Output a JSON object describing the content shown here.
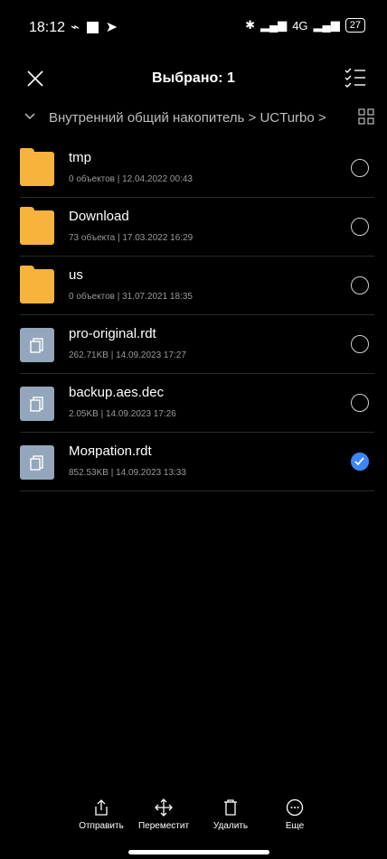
{
  "status_bar": {
    "time": "18:12",
    "network_label": "4G",
    "battery_level": "27"
  },
  "header": {
    "title": "Выбрано: 1"
  },
  "breadcrumb": {
    "path": "Внутренний общий накопитель > UCTurbo >"
  },
  "items": [
    {
      "name": "tmp",
      "meta": "0 объектов  |  12.04.2022 00:43",
      "type": "folder",
      "selected": false
    },
    {
      "name": "Download",
      "meta": "73 объекта  |  17.03.2022 16:29",
      "type": "folder",
      "selected": false
    },
    {
      "name": "us",
      "meta": "0 объектов  |  31.07.2021 18:35",
      "type": "folder",
      "selected": false
    },
    {
      "name": "pro-original.rdt",
      "meta": "262.71KB  |  14.09.2023 17:27",
      "type": "file",
      "selected": false
    },
    {
      "name": "backup.aes.dec",
      "meta": "2.05KB  |  14.09.2023 17:26",
      "type": "file",
      "selected": false
    },
    {
      "name": "Мояраtion.rdt",
      "meta": "852.53KB  |  14.09.2023 13:33",
      "type": "file",
      "selected": true
    }
  ],
  "actions": {
    "send": "Отправить",
    "move": "Переместит",
    "delete": "Удалить",
    "more": "Еще"
  },
  "colors": {
    "folder": "#f8b33c",
    "file": "#93a6bb",
    "accent": "#3b86ff"
  }
}
